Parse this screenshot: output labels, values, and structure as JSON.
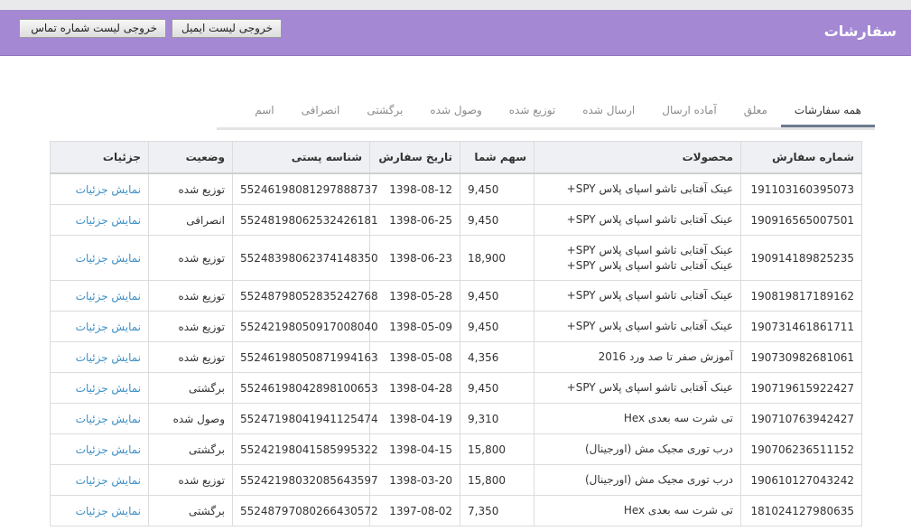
{
  "header": {
    "title": "سفارشات",
    "export_email_label": "خروجی لیست ایمیل",
    "export_phone_label": "خروجی لیست شماره تماس"
  },
  "tabs": [
    {
      "label": "همه سفارشات",
      "active": true
    },
    {
      "label": "معلق",
      "active": false
    },
    {
      "label": "آماده ارسال",
      "active": false
    },
    {
      "label": "ارسال شده",
      "active": false
    },
    {
      "label": "توزیع شده",
      "active": false
    },
    {
      "label": "وصول شده",
      "active": false
    },
    {
      "label": "برگشتی",
      "active": false
    },
    {
      "label": "انصرافی",
      "active": false
    },
    {
      "label": "اسم",
      "active": false
    }
  ],
  "table": {
    "columns": [
      "شماره سفارش",
      "محصولات",
      "سهم شما",
      "تاریخ سفارش",
      "شناسه پستی",
      "وضعیت",
      "جزئیات"
    ],
    "rows": [
      {
        "order": "191103160395073",
        "products": [
          "عینک آفتابی تاشو اسپای پلاس SPY+"
        ],
        "amount": "9,450",
        "date": "1398-08-12",
        "postal": "5524619808129788873​7",
        "status": "توزیع شده",
        "details": "نمایش جزئیات"
      },
      {
        "order": "190916565007501",
        "products": [
          "عینک آفتابی تاشو اسپای پلاس SPY+"
        ],
        "amount": "9,450",
        "date": "1398-06-25",
        "postal": "5524819806253242618​1",
        "status": "انصرافی",
        "details": "نمایش جزئیات"
      },
      {
        "order": "190914189825235",
        "products": [
          "عینک آفتابی تاشو اسپای پلاس SPY+",
          "عینک آفتابی تاشو اسپای پلاس SPY+"
        ],
        "amount": "18,900",
        "date": "1398-06-23",
        "postal": "5524839806237414835​0",
        "status": "توزیع شده",
        "details": "نمایش جزئیات"
      },
      {
        "order": "190819817189162",
        "products": [
          "عینک آفتابی تاشو اسپای پلاس SPY+"
        ],
        "amount": "9,450",
        "date": "1398-05-28",
        "postal": "5524879805283524276​8",
        "status": "توزیع شده",
        "details": "نمایش جزئیات"
      },
      {
        "order": "190731461861711",
        "products": [
          "عینک آفتابی تاشو اسپای پلاس SPY+"
        ],
        "amount": "9,450",
        "date": "1398-05-09",
        "postal": "5524219805091700804​0",
        "status": "توزیع شده",
        "details": "نمایش جزئیات"
      },
      {
        "order": "190730982681061",
        "products": [
          "آموزش صفر تا صد ورد 2016"
        ],
        "amount": "4,356",
        "date": "1398-05-08",
        "postal": "5524619805087199416​3",
        "status": "توزیع شده",
        "details": "نمایش جزئیات"
      },
      {
        "order": "190719615922427",
        "products": [
          "عینک آفتابی تاشو اسپای پلاس SPY+"
        ],
        "amount": "9,450",
        "date": "1398-04-28",
        "postal": "5524619804289810065​3",
        "status": "برگشتی",
        "details": "نمایش جزئیات"
      },
      {
        "order": "190710763942427",
        "products": [
          "تی شرت سه بعدی Hex"
        ],
        "amount": "9,310",
        "date": "1398-04-19",
        "postal": "5524719804194112547​4",
        "status": "وصول شده",
        "details": "نمایش جزئیات"
      },
      {
        "order": "190706236511152",
        "products": [
          "درب توری مجیک مش (اورجینال)"
        ],
        "amount": "15,800",
        "date": "1398-04-15",
        "postal": "5524219804158599532​2",
        "status": "برگشتی",
        "details": "نمایش جزئیات"
      },
      {
        "order": "190610127043242",
        "products": [
          "درب توری مجیک مش (اورجینال)"
        ],
        "amount": "15,800",
        "date": "1398-03-20",
        "postal": "5524219803208564359​7",
        "status": "توزیع شده",
        "details": "نمایش جزئیات"
      },
      {
        "order": "181024127980635",
        "products": [
          "تی شرت سه بعدی Hex"
        ],
        "amount": "7,350",
        "date": "1397-08-02",
        "postal": "5524879708026643057​2",
        "status": "برگشتی",
        "details": "نمایش جزئیات"
      }
    ]
  }
}
